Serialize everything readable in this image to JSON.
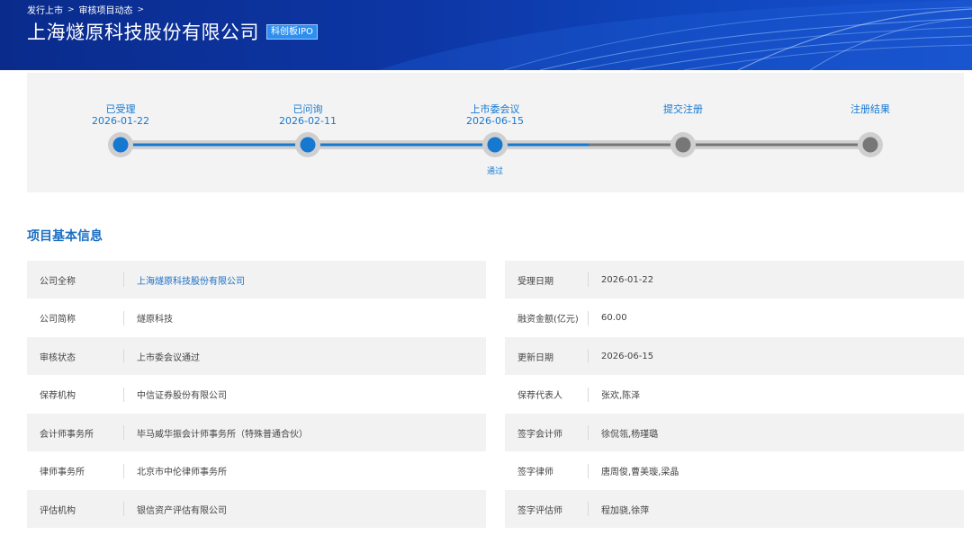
{
  "breadcrumb": [
    "发行上市",
    "审核项目动态"
  ],
  "company": {
    "title": "上海燧原科技股份有限公司",
    "badge": "科创板IPO"
  },
  "timeline": {
    "steps": [
      {
        "name": "已受理",
        "date": "2026-01-22",
        "status": "done"
      },
      {
        "name": "已问询",
        "date": "2026-02-11",
        "status": "done"
      },
      {
        "name": "上市委会议",
        "date": "2026-06-15",
        "status": "done",
        "note": "通过"
      },
      {
        "name": "提交注册",
        "date": "",
        "status": "pending"
      },
      {
        "name": "注册结果",
        "date": "",
        "status": "pending"
      }
    ],
    "colors": {
      "done": "#1778d0",
      "pending": "#777777",
      "track": "#d0d0d0"
    }
  },
  "section_title": "项目基本信息",
  "info": {
    "left": [
      {
        "label": "公司全称",
        "value": "上海燧原科技股份有限公司",
        "link": true
      },
      {
        "label": "公司简称",
        "value": "燧原科技"
      },
      {
        "label": "审核状态",
        "value": "上市委会议通过"
      },
      {
        "label": "保荐机构",
        "value": "中信证券股份有限公司"
      },
      {
        "label": "会计师事务所",
        "value": "毕马威华振会计师事务所（特殊普通合伙）"
      },
      {
        "label": "律师事务所",
        "value": "北京市中伦律师事务所"
      },
      {
        "label": "评估机构",
        "value": "银信资产评估有限公司"
      }
    ],
    "right": [
      {
        "label": "受理日期",
        "value": "2026-01-22"
      },
      {
        "label": "融资金额(亿元)",
        "value": "60.00"
      },
      {
        "label": "更新日期",
        "value": "2026-06-15"
      },
      {
        "label": "保荐代表人",
        "value": "张欢,陈泽"
      },
      {
        "label": "签字会计师",
        "value": "徐侃瓴,杨瑾璐"
      },
      {
        "label": "签字律师",
        "value": "唐周俊,曹美璇,梁晶"
      },
      {
        "label": "签字评估师",
        "value": "程加骁,徐萍"
      }
    ]
  }
}
